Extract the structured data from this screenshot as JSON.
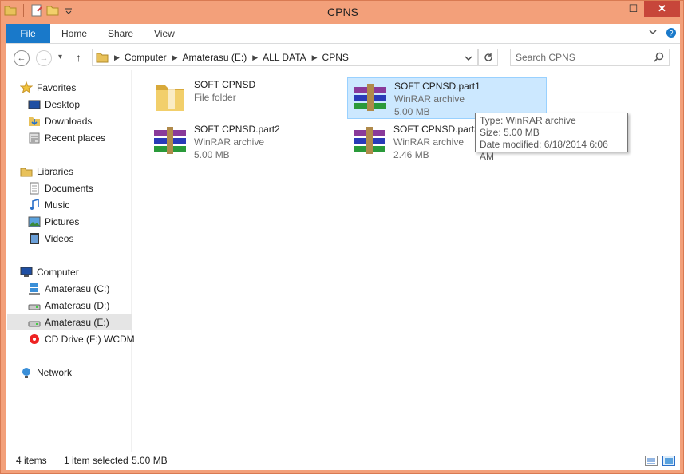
{
  "window": {
    "title": "CPNS"
  },
  "qat": {
    "icons": [
      "folder-icon",
      "properties-icon",
      "new-folder-icon",
      "customize-dropdown-icon"
    ]
  },
  "window_buttons": {
    "minimize": "—",
    "maximize": "☐",
    "close": "✕"
  },
  "ribbon": {
    "tabs": [
      {
        "label": "File"
      },
      {
        "label": "Home"
      },
      {
        "label": "Share"
      },
      {
        "label": "View"
      }
    ]
  },
  "nav_buttons": {
    "back": "←",
    "forward": "→",
    "recent": "▾",
    "up": "↑"
  },
  "address": {
    "crumbs": [
      "Computer",
      "Amaterasu (E:)",
      "ALL DATA",
      "CPNS"
    ]
  },
  "search": {
    "placeholder": "Search CPNS"
  },
  "sidebar": {
    "items": [
      {
        "label": "Favorites",
        "icon": "star-icon"
      },
      {
        "label": "Desktop",
        "icon": "desktop-icon"
      },
      {
        "label": "Downloads",
        "icon": "downloads-icon"
      },
      {
        "label": "Recent places",
        "icon": "recent-places-icon"
      },
      {
        "label": "Libraries",
        "icon": "libraries-icon"
      },
      {
        "label": "Documents",
        "icon": "documents-icon"
      },
      {
        "label": "Music",
        "icon": "music-icon"
      },
      {
        "label": "Pictures",
        "icon": "pictures-icon"
      },
      {
        "label": "Videos",
        "icon": "videos-icon"
      },
      {
        "label": "Computer",
        "icon": "computer-icon"
      },
      {
        "label": "Amaterasu (C:)",
        "icon": "system-drive-icon"
      },
      {
        "label": "Amaterasu (D:)",
        "icon": "drive-icon"
      },
      {
        "label": "Amaterasu (E:)",
        "icon": "drive-icon",
        "selected": true
      },
      {
        "label": "CD Drive (F:) WCDM",
        "icon": "cd-drive-icon"
      },
      {
        "label": "Network",
        "icon": "network-icon"
      }
    ]
  },
  "files": [
    {
      "name": "SOFT CPNSD",
      "type": "File folder",
      "size": "",
      "icon": "folder-icon"
    },
    {
      "name": "SOFT CPNSD.part1",
      "type": "WinRAR archive",
      "size": "5.00 MB",
      "icon": "winrar-icon",
      "selected": true
    },
    {
      "name": "SOFT CPNSD.part2",
      "type": "WinRAR archive",
      "size": "5.00 MB",
      "icon": "winrar-icon"
    },
    {
      "name": "SOFT CPNSD.part3",
      "type": "WinRAR archive",
      "size": "2.46 MB",
      "icon": "winrar-icon"
    }
  ],
  "tooltip": {
    "type": "Type: WinRAR archive",
    "size": "Size: 5.00 MB",
    "modified": "Date modified: 6/18/2014 6:06 AM"
  },
  "status": {
    "count": "4 items",
    "selected": "1 item selected",
    "size": "5.00 MB"
  },
  "colors": {
    "frame": "#f3a07a",
    "accent": "#1979ca",
    "selection": "#cce8ff",
    "close": "#c7463a"
  }
}
